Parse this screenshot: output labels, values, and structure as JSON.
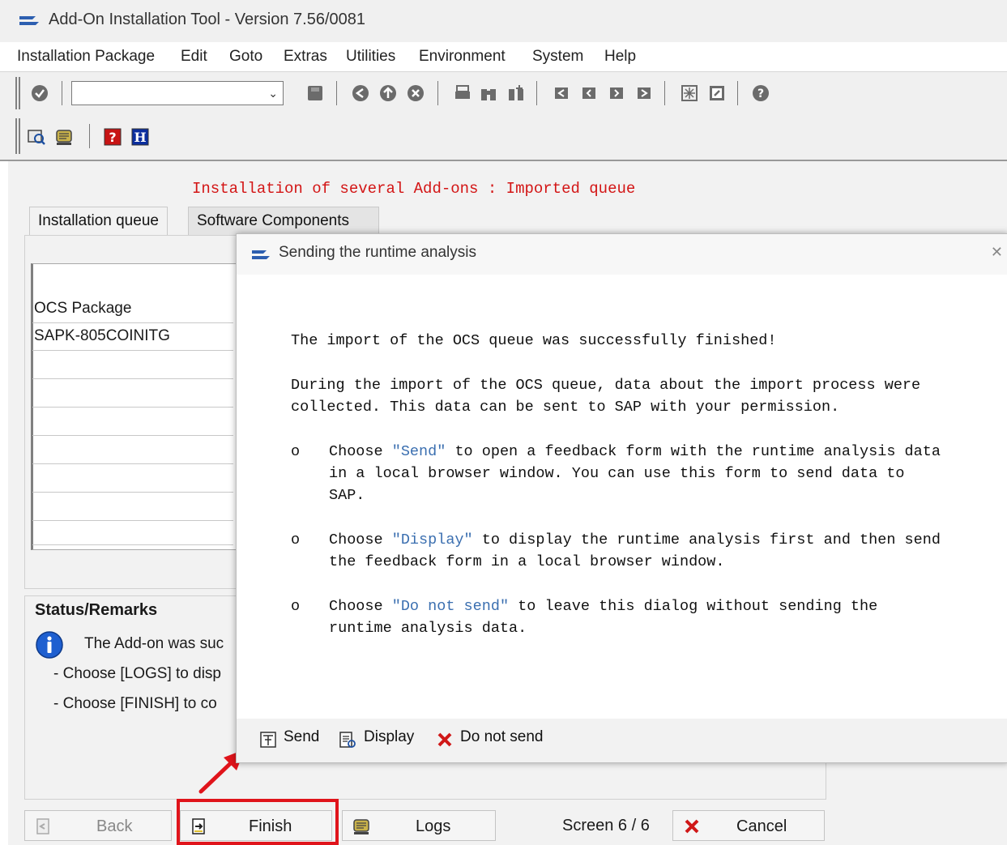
{
  "window": {
    "title": "Add-On Installation Tool - Version 7.56/0081"
  },
  "menu": {
    "items": [
      "Installation Package",
      "Edit",
      "Goto",
      "Extras",
      "Utilities",
      "Environment",
      "System",
      "Help"
    ]
  },
  "toolbar": {
    "command_field_value": "",
    "icons": [
      "enter-icon",
      "save-icon",
      "back-icon",
      "exit-icon",
      "cancel-icon",
      "print-icon",
      "find-icon",
      "find-next-icon",
      "first-page-icon",
      "previous-page-icon",
      "next-page-icon",
      "last-page-icon",
      "create-session-icon",
      "shortcut-icon",
      "help-icon"
    ],
    "app_icons": [
      "overview-icon",
      "logs-icon",
      "help-red-icon",
      "info-blue-icon"
    ]
  },
  "main": {
    "heading": "Installation of several Add-ons : Imported queue",
    "tabs": [
      {
        "label": "Installation queue",
        "active": true
      },
      {
        "label": "Software Components",
        "active": false
      }
    ],
    "queue_table": {
      "column_header": "OCS Package",
      "rows": [
        "SAPK-805COINITG",
        "",
        "",
        "",
        "",
        "",
        "",
        ""
      ]
    },
    "status": {
      "title": "Status/Remarks",
      "lines": [
        "The Add-on was suc",
        "- Choose [LOGS] to disp",
        "- Choose [FINISH] to co"
      ]
    }
  },
  "footer": {
    "back_label": "Back",
    "finish_label": "Finish",
    "logs_label": "Logs",
    "screen_label": "Screen 6 / 6",
    "cancel_label": "Cancel"
  },
  "dialog": {
    "title": "Sending the runtime analysis",
    "close_glyph": "✕",
    "intro": "The import of the OCS queue was successfully finished!",
    "para1_line1": "During the import of the OCS queue, data about the import process were",
    "para1_line2": "collected. This data can be sent to SAP with your permission.",
    "bullet_marker": "o",
    "b1_pre": "Choose ",
    "b1_link": "\"Send\"",
    "b1_post": " to open a feedback form with the runtime analysis data",
    "b1_line2": "in a local browser window. You can use this form to send data to",
    "b1_line3": "SAP.",
    "b2_pre": "Choose ",
    "b2_link": "\"Display\"",
    "b2_post": " to display the runtime analysis first and then send",
    "b2_line2": "the feedback form in a local browser window.",
    "b3_pre": "Choose ",
    "b3_link": "\"Do not send\"",
    "b3_post": " to leave this dialog without sending the",
    "b3_line2": "runtime analysis data.",
    "buttons": {
      "send": "Send",
      "display": "Display",
      "do_not_send": "Do not send"
    }
  },
  "colors": {
    "heading_red": "#d31515",
    "link_blue": "#3b6fb0",
    "highlight_red": "#e0141b"
  }
}
